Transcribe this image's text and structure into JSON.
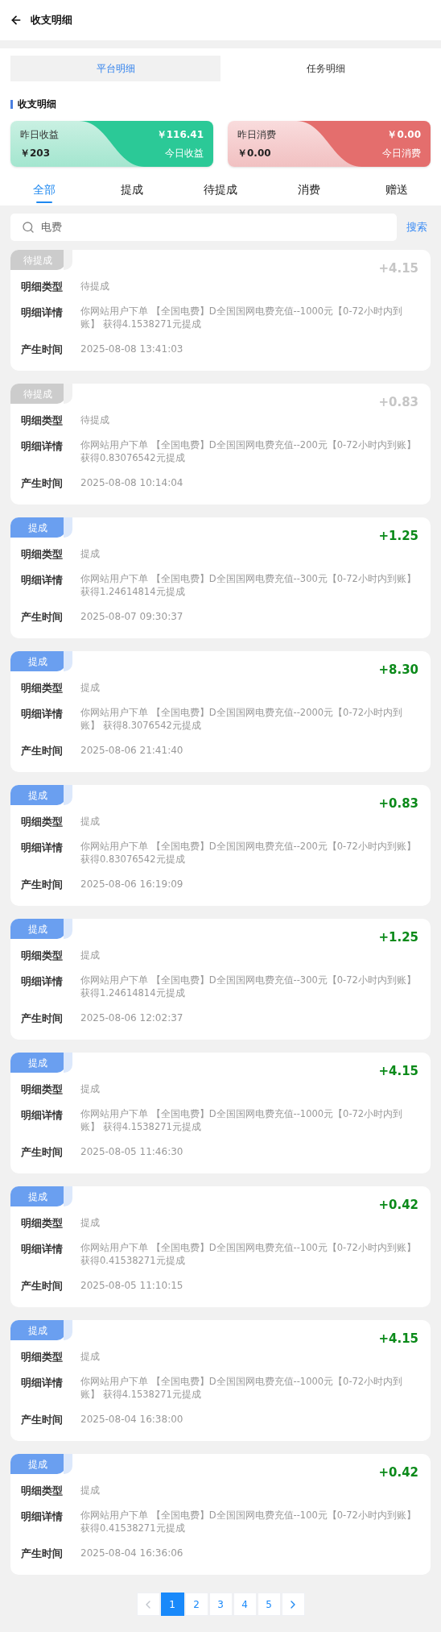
{
  "header": {
    "title": "收支明细"
  },
  "segments": [
    {
      "label": "平台明细",
      "selected": true
    },
    {
      "label": "任务明细",
      "selected": false
    }
  ],
  "section_title": "收支明细",
  "summary": [
    {
      "kind": "income",
      "label": "昨日收益",
      "value": "￥203",
      "today_value": "￥116.41",
      "today_label": "今日收益"
    },
    {
      "kind": "expense",
      "label": "昨日消费",
      "value": "￥0.00",
      "today_value": "￥0.00",
      "today_label": "今日消费"
    }
  ],
  "tabs": [
    {
      "label": "全部",
      "selected": true
    },
    {
      "label": "提成",
      "selected": false
    },
    {
      "label": "待提成",
      "selected": false
    },
    {
      "label": "消费",
      "selected": false
    },
    {
      "label": "赠送",
      "selected": false
    }
  ],
  "search": {
    "value": "电费",
    "button": "搜索"
  },
  "records": [
    {
      "kind": "pending",
      "badge": "待提成",
      "amount": "+4.15",
      "type_label": "明细类型",
      "type": "待提成",
      "detail_label": "明细详情",
      "detail": "你网站用户下单 【全国电费】D全国国网电费充值--1000元【0-72小时内到账】 获得4.1538271元提成",
      "time_label": "产生时间",
      "time": "2025-08-08 13:41:03"
    },
    {
      "kind": "pending",
      "badge": "待提成",
      "amount": "+0.83",
      "type_label": "明细类型",
      "type": "待提成",
      "detail_label": "明细详情",
      "detail": "你网站用户下单 【全国电费】D全国国网电费充值--200元【0-72小时内到账】获得0.83076542元提成",
      "time_label": "产生时间",
      "time": "2025-08-08 10:14:04"
    },
    {
      "kind": "commission",
      "badge": "提成",
      "amount": "+1.25",
      "type_label": "明细类型",
      "type": "提成",
      "detail_label": "明细详情",
      "detail": "你网站用户下单 【全国电费】D全国国网电费充值--300元【0-72小时内到账】获得1.24614814元提成",
      "time_label": "产生时间",
      "time": "2025-08-07 09:30:37"
    },
    {
      "kind": "commission",
      "badge": "提成",
      "amount": "+8.30",
      "type_label": "明细类型",
      "type": "提成",
      "detail_label": "明细详情",
      "detail": "你网站用户下单 【全国电费】D全国国网电费充值--2000元【0-72小时内到账】 获得8.3076542元提成",
      "time_label": "产生时间",
      "time": "2025-08-06 21:41:40"
    },
    {
      "kind": "commission",
      "badge": "提成",
      "amount": "+0.83",
      "type_label": "明细类型",
      "type": "提成",
      "detail_label": "明细详情",
      "detail": "你网站用户下单 【全国电费】D全国国网电费充值--200元【0-72小时内到账】获得0.83076542元提成",
      "time_label": "产生时间",
      "time": "2025-08-06 16:19:09"
    },
    {
      "kind": "commission",
      "badge": "提成",
      "amount": "+1.25",
      "type_label": "明细类型",
      "type": "提成",
      "detail_label": "明细详情",
      "detail": "你网站用户下单 【全国电费】D全国国网电费充值--300元【0-72小时内到账】获得1.24614814元提成",
      "time_label": "产生时间",
      "time": "2025-08-06 12:02:37"
    },
    {
      "kind": "commission",
      "badge": "提成",
      "amount": "+4.15",
      "type_label": "明细类型",
      "type": "提成",
      "detail_label": "明细详情",
      "detail": "你网站用户下单 【全国电费】D全国国网电费充值--1000元【0-72小时内到账】 获得4.1538271元提成",
      "time_label": "产生时间",
      "time": "2025-08-05 11:46:30"
    },
    {
      "kind": "commission",
      "badge": "提成",
      "amount": "+0.42",
      "type_label": "明细类型",
      "type": "提成",
      "detail_label": "明细详情",
      "detail": "你网站用户下单 【全国电费】D全国国网电费充值--100元【0-72小时内到账】获得0.41538271元提成",
      "time_label": "产生时间",
      "time": "2025-08-05 11:10:15"
    },
    {
      "kind": "commission",
      "badge": "提成",
      "amount": "+4.15",
      "type_label": "明细类型",
      "type": "提成",
      "detail_label": "明细详情",
      "detail": "你网站用户下单 【全国电费】D全国国网电费充值--1000元【0-72小时内到账】 获得4.1538271元提成",
      "time_label": "产生时间",
      "time": "2025-08-04 16:38:00"
    },
    {
      "kind": "commission",
      "badge": "提成",
      "amount": "+0.42",
      "type_label": "明细类型",
      "type": "提成",
      "detail_label": "明细详情",
      "detail": "你网站用户下单 【全国电费】D全国国网电费充值--100元【0-72小时内到账】获得0.41538271元提成",
      "time_label": "产生时间",
      "time": "2025-08-04 16:36:06"
    }
  ],
  "pagination": {
    "prev_disabled": true,
    "pages": [
      {
        "label": "1",
        "selected": true
      },
      {
        "label": "2",
        "selected": false
      },
      {
        "label": "3",
        "selected": false
      },
      {
        "label": "4",
        "selected": false
      },
      {
        "label": "5",
        "selected": false
      }
    ]
  }
}
